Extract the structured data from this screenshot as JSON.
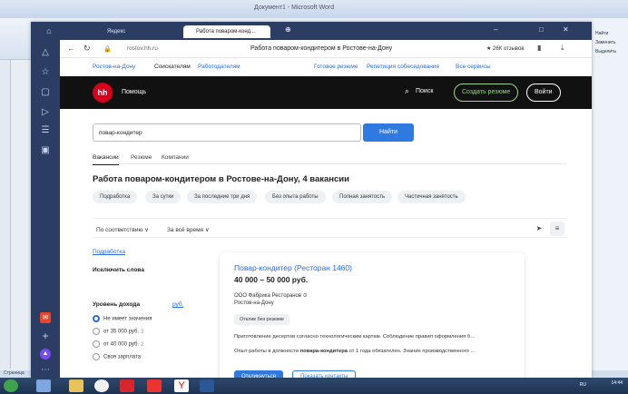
{
  "word": {
    "title": "Документ1 - Microsoft Word",
    "right_items": [
      "Найти",
      "Заменить",
      "Выделить"
    ],
    "status": "Страница"
  },
  "browser": {
    "tabs": [
      {
        "label": "Яндекс"
      },
      {
        "label": "Работа поваром-конд..."
      }
    ],
    "url": "rostov.hh.ru",
    "page_title": "Работа поваром-кондитером в Ростове-на-Дону",
    "reviews": "★ 26К отзывов"
  },
  "topnav": {
    "city": "Ростов-на-Дону",
    "seekers": "Соискателям",
    "employers": "Работодателям",
    "ready_resume": "Готовое резюме",
    "interview": "Репетиция собеседования",
    "all_services": "Все сервисы"
  },
  "header": {
    "logo": "hh",
    "help": "Помощь",
    "search": "Поиск",
    "create_resume": "Создать резюме",
    "login": "Войти"
  },
  "search": {
    "query": "повар-кондитер",
    "button": "Найти"
  },
  "page_tabs": [
    "Вакансии",
    "Резюме",
    "Компании"
  ],
  "results_title": "Работа поваром-кондитером в Ростове-на-Дону, 4 вакансии",
  "chips": [
    "Подработка",
    "За сутки",
    "За последние три дня",
    "Без опыта работы",
    "Полная занятость",
    "Частичная занятость"
  ],
  "sort": {
    "order": "По соответствию",
    "period": "За всё время"
  },
  "filters": {
    "part_time": "Подработка",
    "exclude_words": "Исключить слова",
    "income_title": "Уровень дохода",
    "income_currency": "руб.",
    "options": [
      {
        "label": "Не имеет значения",
        "count": ""
      },
      {
        "label": "от 35 000 руб.",
        "count": "3"
      },
      {
        "label": "от 40 000 руб.",
        "count": "2"
      },
      {
        "label": "Своя зарплата",
        "count": ""
      }
    ]
  },
  "vacancy": {
    "title": "Повар-кондитер (Ресторан 1460)",
    "salary": "40 000 – 50 000 руб.",
    "company": "ООО Фабрика Ресторанов",
    "city": "Ростов-на-Дону",
    "badge": "Отклик без резюме",
    "desc1": "Приготовление десертов согласно технологическим картам. Соблюдение правил оформления б...",
    "desc2_a": "Опыт работы в должности ",
    "desc2_b": "повара-кондитера",
    "desc2_c": " от 1 года обязателен. Знание производственного ...",
    "respond": "Откликнуться",
    "contacts": "Показать контакты"
  },
  "tray": {
    "lang": "RU",
    "time": "14:44"
  }
}
